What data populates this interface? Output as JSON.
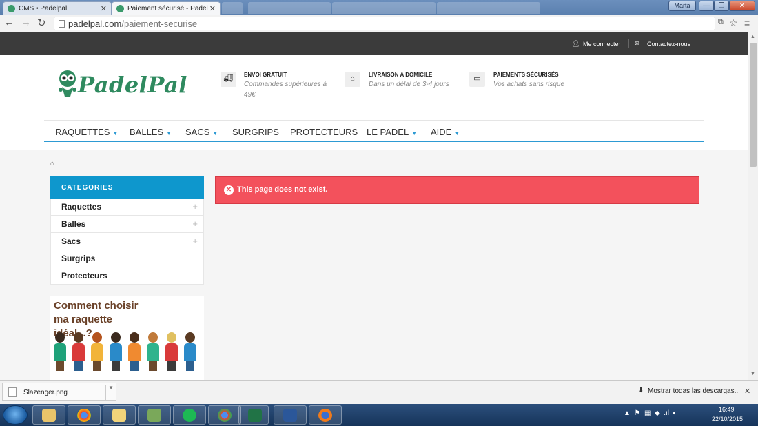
{
  "browser": {
    "tabs": [
      {
        "title": "CMS • Padelpal",
        "active": false
      },
      {
        "title": "Paiement sécurisé - Padel",
        "active": true
      }
    ],
    "user_label": "Marta",
    "url_host": "padelpal.com",
    "url_path": "/paiement-securise"
  },
  "topbar": {
    "login": "Me connecter",
    "contact": "Contactez-nous"
  },
  "header": {
    "logo_text": "PadelPal",
    "features": [
      {
        "title": "ENVOI GRATUIT",
        "subtitle": "Commandes supérieures à 49€",
        "icon": "truck-icon"
      },
      {
        "title": "LIVRAISON A DOMICILE",
        "subtitle": "Dans un délai de 3-4 jours",
        "icon": "home-icon"
      },
      {
        "title": "PAIEMENTS SÉCURISÉS",
        "subtitle": "Vos achats sans risque",
        "icon": "credit-card-icon"
      }
    ]
  },
  "nav": {
    "items": [
      {
        "label": "RAQUETTES",
        "dropdown": true
      },
      {
        "label": "BALLES",
        "dropdown": true
      },
      {
        "label": "SACS",
        "dropdown": true
      },
      {
        "label": "SURGRIPS",
        "dropdown": false
      },
      {
        "label": "PROTECTEURS",
        "dropdown": false
      },
      {
        "label": "LE PADEL",
        "dropdown": true
      },
      {
        "label": "AIDE",
        "dropdown": true
      }
    ]
  },
  "sidebar": {
    "title": "CATEGORIES",
    "items": [
      {
        "label": "Raquettes",
        "expandable": true
      },
      {
        "label": "Balles",
        "expandable": true
      },
      {
        "label": "Sacs",
        "expandable": true
      },
      {
        "label": "Surgrips",
        "expandable": false
      },
      {
        "label": "Protecteurs",
        "expandable": false
      }
    ],
    "promo_title": "Comment choisir ma raquette idéal...?"
  },
  "main": {
    "error_message": "This page does not exist."
  },
  "downloads": {
    "file_name": "Slazenger.png",
    "show_all": "Mostrar todas las descargas..."
  },
  "taskbar": {
    "time": "16:49",
    "date": "22/10/2015"
  },
  "colors": {
    "brand_green": "#2f8a5f",
    "accent_blue": "#0e97cd",
    "error_red": "#f3515c",
    "topbar_dark": "#3b3b3b"
  }
}
